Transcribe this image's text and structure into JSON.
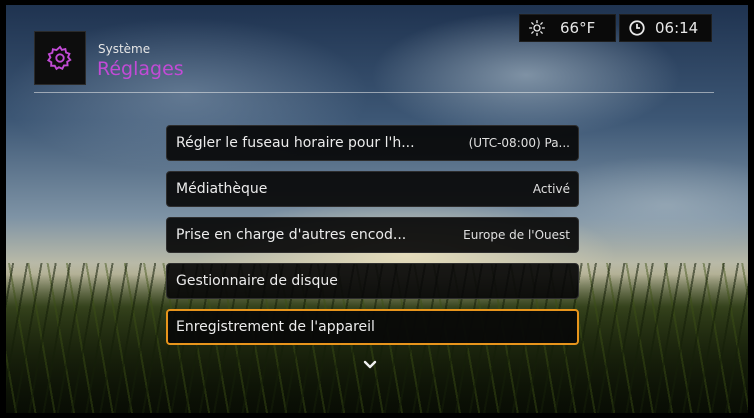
{
  "header": {
    "parent": "Système",
    "title": "Réglages",
    "app_icon": "gear-icon",
    "accent_color": "#c24bd6"
  },
  "status": {
    "weather_icon": "sun-icon",
    "temperature": "66°F",
    "clock_icon": "clock-icon",
    "time": "06:14"
  },
  "menu": {
    "items": [
      {
        "label": "Régler le fuseau horaire pour l'h...",
        "value": "(UTC-08:00) Pa..."
      },
      {
        "label": "Médiathèque",
        "value": "Activé"
      },
      {
        "label": "Prise en charge d'autres encod...",
        "value": "Europe de l'Ouest"
      },
      {
        "label": "Gestionnaire de disque",
        "value": ""
      },
      {
        "label": "Enregistrement de l'appareil",
        "value": ""
      }
    ],
    "selected_index": 4,
    "selected_color": "#e8951c",
    "more_icon": "chevron-down-icon"
  }
}
